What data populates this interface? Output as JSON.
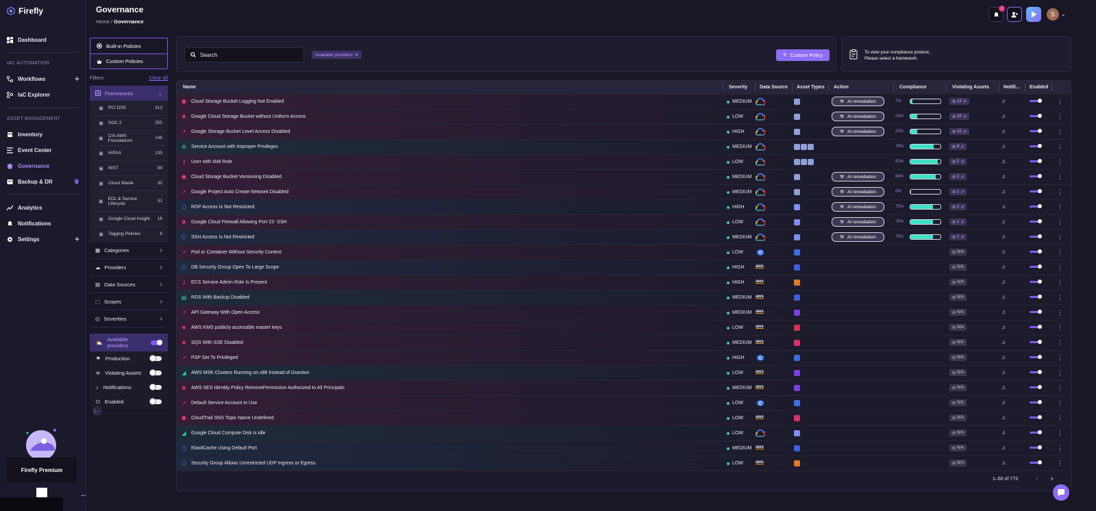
{
  "app": {
    "name": "Firefly"
  },
  "header": {
    "title": "Governance",
    "crumb_home": "Home",
    "crumb_sep": "/",
    "crumb_current": "Governance",
    "notif_count": "1",
    "avatar_letter": "S"
  },
  "nav": {
    "dashboard": "Dashboard",
    "sec_iac": "IAC AUTOMATION",
    "workflows": "Workflows",
    "iac_explorer": "IaC Explorer",
    "sec_asset": "ASSET MANAGEMENT",
    "inventory": "Inventory",
    "event_center": "Event Center",
    "governance": "Governance",
    "backup": "Backup & DR",
    "analytics": "Analytics",
    "notifications": "Notifications",
    "settings": "Settings",
    "premium": "Firefly Premium"
  },
  "panel": {
    "builtin": "Built-in Policies",
    "custom": "Custom Policies",
    "filters": "Filters",
    "clear_all": "Clear all",
    "frameworks": "Frameworks",
    "framework_items": [
      {
        "label": "PCI DSS",
        "count": "313",
        "icon": "card-icon"
      },
      {
        "label": "SOC 2",
        "count": "255",
        "icon": "shield-icon"
      },
      {
        "label": "CIS AWS Foundations",
        "count": "146",
        "icon": "cis-icon"
      },
      {
        "label": "HIPAA",
        "count": "135",
        "icon": "caduceus-icon"
      },
      {
        "label": "NIST",
        "count": "98",
        "icon": "nist-icon"
      },
      {
        "label": "Cloud Waste",
        "count": "35",
        "icon": "cloud-icon"
      },
      {
        "label": "EOL & Service Lifecycle",
        "count": "31",
        "icon": "clock-icon"
      },
      {
        "label": "Google Cloud Insight",
        "count": "16",
        "icon": "insight-icon"
      },
      {
        "label": "Tagging Policies",
        "count": "8",
        "icon": "tag-icon"
      }
    ],
    "categories": "Categories",
    "providers": "Providers",
    "data_sources": "Data Sources",
    "scopes": "Scopes",
    "severities": "Severities",
    "available_providers": "Available providers",
    "production": "Production",
    "violating_assets": "Violating Assets",
    "notifications": "Notifications",
    "enabled": "Enabled"
  },
  "search": {
    "placeholder": "Search",
    "chip": "Available providers",
    "custom_policy": "Custom Policy"
  },
  "compliance_hint": {
    "line1": "To view your compliance posture,",
    "line2": "Please select a framework."
  },
  "table": {
    "columns": {
      "name": "Name",
      "severity": "Severity",
      "data_source": "Data Source",
      "asset_types": "Asset Types",
      "action": "Action",
      "compliance": "Compliance",
      "violating_assets": "Violating Assets",
      "notifications": "Notifi...",
      "enabled": "Enabled"
    },
    "ai_label": "AI remediation",
    "rows": [
      {
        "name": "Cloud Storage Bucket Logging Not Enabled",
        "icon": "shield-alert-icon",
        "icon_color": "#e0367a",
        "severity": "MEDIUM",
        "source": "gcp",
        "asset_colors": [
          "#8f9fd8"
        ],
        "ai": true,
        "pct": "7%",
        "fill": 0.07,
        "va": "12"
      },
      {
        "name": "Google Cloud Storage Bucket without Uniform Access",
        "icon": "spider-icon",
        "icon_color": "#e0367a",
        "severity": "LOW",
        "source": "gcp",
        "asset_colors": [
          "#8f9fd8"
        ],
        "ai": true,
        "pct": "23%",
        "fill": 0.23,
        "va": "10"
      },
      {
        "name": "Google Storage Bucket Level Access Disabled",
        "icon": "trend-icon",
        "icon_color": "#e0367a",
        "severity": "HIGH",
        "source": "gcp",
        "asset_colors": [
          "#8f9fd8"
        ],
        "ai": true,
        "pct": "23%",
        "fill": 0.23,
        "va": "10"
      },
      {
        "name": "Service Account with Improper Privileges",
        "icon": "robot-icon",
        "icon_color": "#3ac7b1",
        "severity": "MEDIUM",
        "source": "gcp",
        "asset_colors": [
          "#8f9fd8",
          "#8f9fd8",
          "#8f9fd8"
        ],
        "ai": false,
        "pct": "78%",
        "fill": 0.78,
        "va": "6"
      },
      {
        "name": "User with IAM Role",
        "icon": "key-icon",
        "icon_color": "#e0367a",
        "severity": "LOW",
        "source": "gcp",
        "asset_colors": [
          "#8f9fd8",
          "#8f9fd8",
          "#8f9fd8"
        ],
        "ai": false,
        "pct": "92%",
        "fill": 0.92,
        "va": "2"
      },
      {
        "name": "Cloud Storage Bucket Versioning Disabled",
        "icon": "shield-alert-icon",
        "icon_color": "#e0367a",
        "severity": "MEDIUM",
        "source": "gcp",
        "asset_colors": [
          "#8f9fd8"
        ],
        "ai": true,
        "pct": "84%",
        "fill": 0.84,
        "va": "2"
      },
      {
        "name": "Google Project Auto Create Network Disabled",
        "icon": "trend-icon",
        "icon_color": "#e0367a",
        "severity": "MEDIUM",
        "source": "gcp",
        "asset_colors": [
          "#8f9fd8"
        ],
        "ai": true,
        "pct": "0%",
        "fill": 0,
        "va": "1"
      },
      {
        "name": "RDP Access Is Not Restricted",
        "icon": "cubes-icon",
        "icon_color": "#4aa3f0",
        "severity": "HIGH",
        "source": "gcp",
        "asset_colors": [
          "#7f8ef0"
        ],
        "ai": true,
        "pct": "75%",
        "fill": 0.75,
        "va": "1"
      },
      {
        "name": "Google Cloud Firewall Allowing Port 22- SSH",
        "icon": "spider-icon",
        "icon_color": "#e0367a",
        "severity": "LOW",
        "source": "gcp",
        "asset_colors": [
          "#7f8ef0"
        ],
        "ai": true,
        "pct": "75%",
        "fill": 0.75,
        "va": "1"
      },
      {
        "name": "SSH Access Is Not Restricted",
        "icon": "cubes-icon",
        "icon_color": "#4aa3f0",
        "severity": "MEDIUM",
        "source": "gcp",
        "asset_colors": [
          "#7f8ef0"
        ],
        "ai": true,
        "pct": "75%",
        "fill": 0.75,
        "va": "1"
      },
      {
        "name": "Pod or Container Without Security Context",
        "icon": "trend-icon",
        "icon_color": "#e0367a",
        "severity": "LOW",
        "source": "k8s",
        "asset_colors": [
          "#3b6fe0"
        ],
        "ai": false,
        "va": "N/A"
      },
      {
        "name": "DB Security Group Open To Large Scope",
        "icon": "cubes-icon",
        "icon_color": "#4aa3f0",
        "severity": "HIGH",
        "source": "aws",
        "asset_colors": [
          "#3d5fe0"
        ],
        "ai": false,
        "va": "N/A"
      },
      {
        "name": "ECS Service Admin Role Is Present",
        "icon": "key-icon",
        "icon_color": "#e0367a",
        "severity": "HIGH",
        "source": "aws",
        "asset_colors": [
          "#e07a28"
        ],
        "ai": false,
        "va": "N/A"
      },
      {
        "name": "RDS With Backup Disabled",
        "icon": "db-icon",
        "icon_color": "#3ac7b1",
        "severity": "MEDIUM",
        "source": "aws",
        "asset_colors": [
          "#3d5fe0"
        ],
        "ai": false,
        "va": "N/A"
      },
      {
        "name": "API Gateway With Open Access",
        "icon": "trend-icon",
        "icon_color": "#e0367a",
        "severity": "MEDIUM",
        "source": "aws",
        "asset_colors": [
          "#7b3fe0"
        ],
        "ai": false,
        "va": "N/A"
      },
      {
        "name": "AWS KMS publicly accessible master keys",
        "icon": "spider-icon",
        "icon_color": "#e0367a",
        "severity": "LOW",
        "source": "aws",
        "asset_colors": [
          "#d6334a"
        ],
        "ai": false,
        "va": "N/A"
      },
      {
        "name": "SQS With SSE Disabled",
        "icon": "spider-icon",
        "icon_color": "#e0367a",
        "severity": "MEDIUM",
        "source": "aws",
        "asset_colors": [
          "#d63366"
        ],
        "ai": false,
        "va": "N/A"
      },
      {
        "name": "PSP Set To Privileged",
        "icon": "trend-icon",
        "icon_color": "#e0367a",
        "severity": "HIGH",
        "source": "k8s",
        "asset_colors": [
          "#3b6fe0"
        ],
        "ai": false,
        "va": "N/A"
      },
      {
        "name": "AWS MSK Clusters Running on x86 Instead of Graviton",
        "icon": "chart-icon",
        "icon_color": "#3ac7b1",
        "severity": "LOW",
        "source": "aws",
        "asset_colors": [
          "#7b3fe0"
        ],
        "ai": false,
        "va": "N/A"
      },
      {
        "name": "AWS SES Identity Policy RemovePermission Authorized to All Principals",
        "icon": "spider-icon",
        "icon_color": "#e0367a",
        "severity": "MEDIUM",
        "source": "aws",
        "asset_colors": [
          "#7b3fe0"
        ],
        "ai": false,
        "va": "N/A"
      },
      {
        "name": "Default Service Account In Use",
        "icon": "trend-icon",
        "icon_color": "#e0367a",
        "severity": "LOW",
        "source": "k8s",
        "asset_colors": [
          "#3b6fe0"
        ],
        "ai": false,
        "va": "N/A"
      },
      {
        "name": "CloudTrail SNS Topic Name Undefined",
        "icon": "shield-alert-icon",
        "icon_color": "#e0367a",
        "severity": "LOW",
        "source": "aws",
        "asset_colors": [
          "#d63366"
        ],
        "ai": false,
        "va": "N/A"
      },
      {
        "name": "Google Cloud Compute Disk is idle",
        "icon": "chart-icon",
        "icon_color": "#3ac7b1",
        "severity": "LOW",
        "source": "gcp",
        "asset_colors": [
          "#7f8ef0"
        ],
        "ai": false,
        "va": "N/A"
      },
      {
        "name": "ElastiCache Using Default Port",
        "icon": "cubes-icon",
        "icon_color": "#4aa3f0",
        "severity": "MEDIUM",
        "source": "aws",
        "asset_colors": [
          "#3d5fe0"
        ],
        "ai": false,
        "va": "N/A"
      },
      {
        "name": "Security Group Allows Unrestricted UDP Ingress or Egress",
        "icon": "cubes-icon",
        "icon_color": "#4aa3f0",
        "severity": "LOW",
        "source": "aws",
        "asset_colors": [
          "#e07a28"
        ],
        "ai": false,
        "va": "N/A"
      }
    ]
  },
  "pagination": {
    "label": "1–50 of 773",
    "prev": "‹",
    "next": "›"
  },
  "colors": {
    "accent": "#8d6df5",
    "teal": "#3ee0c6",
    "bg": "#181726"
  }
}
